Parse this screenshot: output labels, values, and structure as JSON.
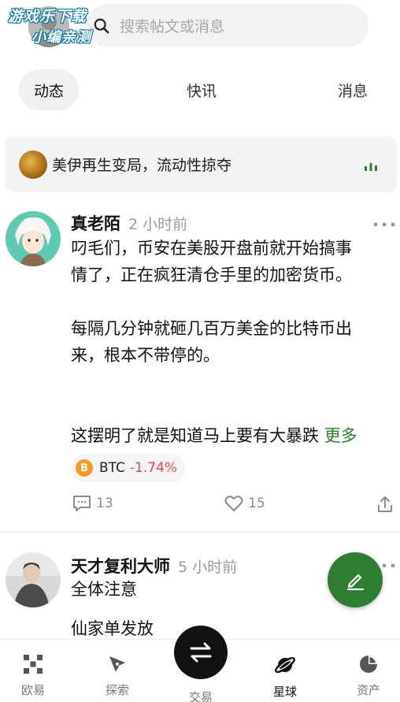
{
  "watermark": {
    "line1": "游戏乐下载",
    "line2": "小编亲测"
  },
  "search": {
    "placeholder": "搜索帖文或消息"
  },
  "tabs": [
    {
      "label": "动态",
      "active": true
    },
    {
      "label": "快讯",
      "active": false
    },
    {
      "label": "消息",
      "active": false
    }
  ],
  "banner": {
    "text": "美伊再生变局，流动性掠夺"
  },
  "posts": [
    {
      "author": "真老陌",
      "time": "2 小时前",
      "body_lines": [
        "叼毛们，币安在美股开盘前就开始搞事",
        "情了，正在疯狂清仓手里的加密货币。",
        "",
        "每隔几分钟就砸几百万美金的比特币出",
        "来，根本不带停的。",
        "",
        "",
        "这摆明了就是知道马上要有大暴跌"
      ],
      "more_label": "更多",
      "tag": {
        "symbol": "BTC",
        "icon_letter": "B",
        "change": "-1.74%"
      },
      "comments": "13",
      "likes": "15"
    },
    {
      "author": "天才复利大师",
      "time": "5 小时前",
      "body_lines": [
        "全体注意",
        "仙家单发放"
      ]
    }
  ],
  "nav": [
    {
      "label": "欧易",
      "icon": "okx-logo-icon"
    },
    {
      "label": "探索",
      "icon": "compass-icon"
    },
    {
      "label": "交易",
      "icon": "swap-arrows-icon"
    },
    {
      "label": "星球",
      "icon": "planet-icon",
      "active": true
    },
    {
      "label": "资产",
      "icon": "pie-chart-icon"
    }
  ],
  "colors": {
    "accent": "#2e7d32",
    "negative": "#e0475a",
    "btc": "#f29b27"
  }
}
